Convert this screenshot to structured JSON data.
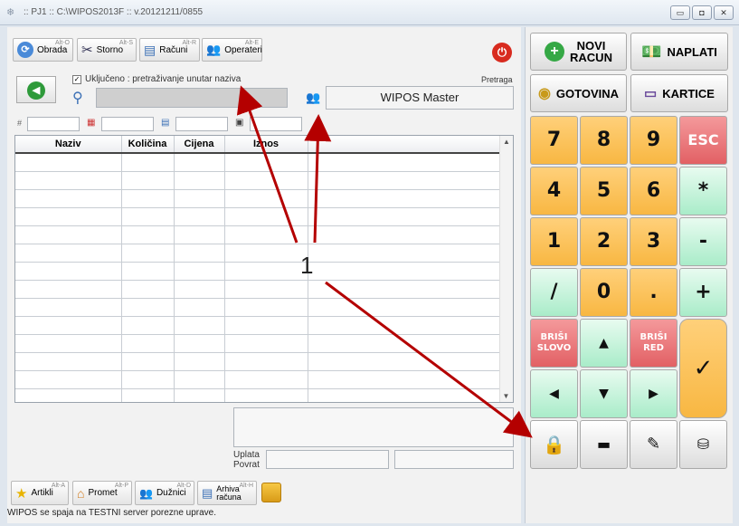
{
  "window": {
    "title": ":: PJ1 :: C:\\WIPOS2013F :: v.20121211/0855"
  },
  "toolbar": {
    "obrada": {
      "label": "Obrada",
      "hotkey": "Alt-O"
    },
    "storno": {
      "label": "Storno",
      "hotkey": "Alt-S"
    },
    "racuni": {
      "label": "Računi",
      "hotkey": "Alt-R"
    },
    "operateri": {
      "label": "Operateri",
      "hotkey": "Alt-E"
    }
  },
  "search": {
    "checkbox_label": "Uključeno : pretraživanje unutar naziva",
    "pretraga_label": "Pretraga"
  },
  "operator": {
    "name": "WIPOS Master"
  },
  "table": {
    "columns": [
      "Naziv",
      "Količina",
      "Cijena",
      "Iznos",
      ""
    ],
    "row_count": 14
  },
  "totals": {
    "uplata": "Uplata",
    "povrat": "Povrat"
  },
  "bottom_toolbar": {
    "artikli": {
      "label": "Artikli",
      "hotkey": "Alt-A"
    },
    "promet": {
      "label": "Promet",
      "hotkey": "Alt-P"
    },
    "duznici": {
      "label": "Dužnici",
      "hotkey": "Alt-D"
    },
    "arhiva": {
      "label": "Arhiva\nračuna",
      "hotkey": "Alt-H"
    }
  },
  "status": "WIPOS se spaja na TESTNI server porezne uprave.",
  "right_panel": {
    "novi_racun": "NOVI\nRACUN",
    "naplati": "NAPLATI",
    "gotovina": "GOTOVINA",
    "kartice": "KARTICE",
    "keys": [
      "7",
      "8",
      "9",
      "ESC",
      "4",
      "5",
      "6",
      "*",
      "1",
      "2",
      "3",
      "-",
      "/",
      "0",
      ".",
      "+"
    ],
    "brisi_slovo": "BRIŠI\nSLOVO",
    "brisi_red": "BRIŠI\nRED",
    "checkmark": "✓"
  },
  "annotation": {
    "label": "1"
  },
  "colors": {
    "orange": "#f8b742",
    "green": "#a9ecc9",
    "red": "#e26064",
    "arrow": "#b40000"
  }
}
